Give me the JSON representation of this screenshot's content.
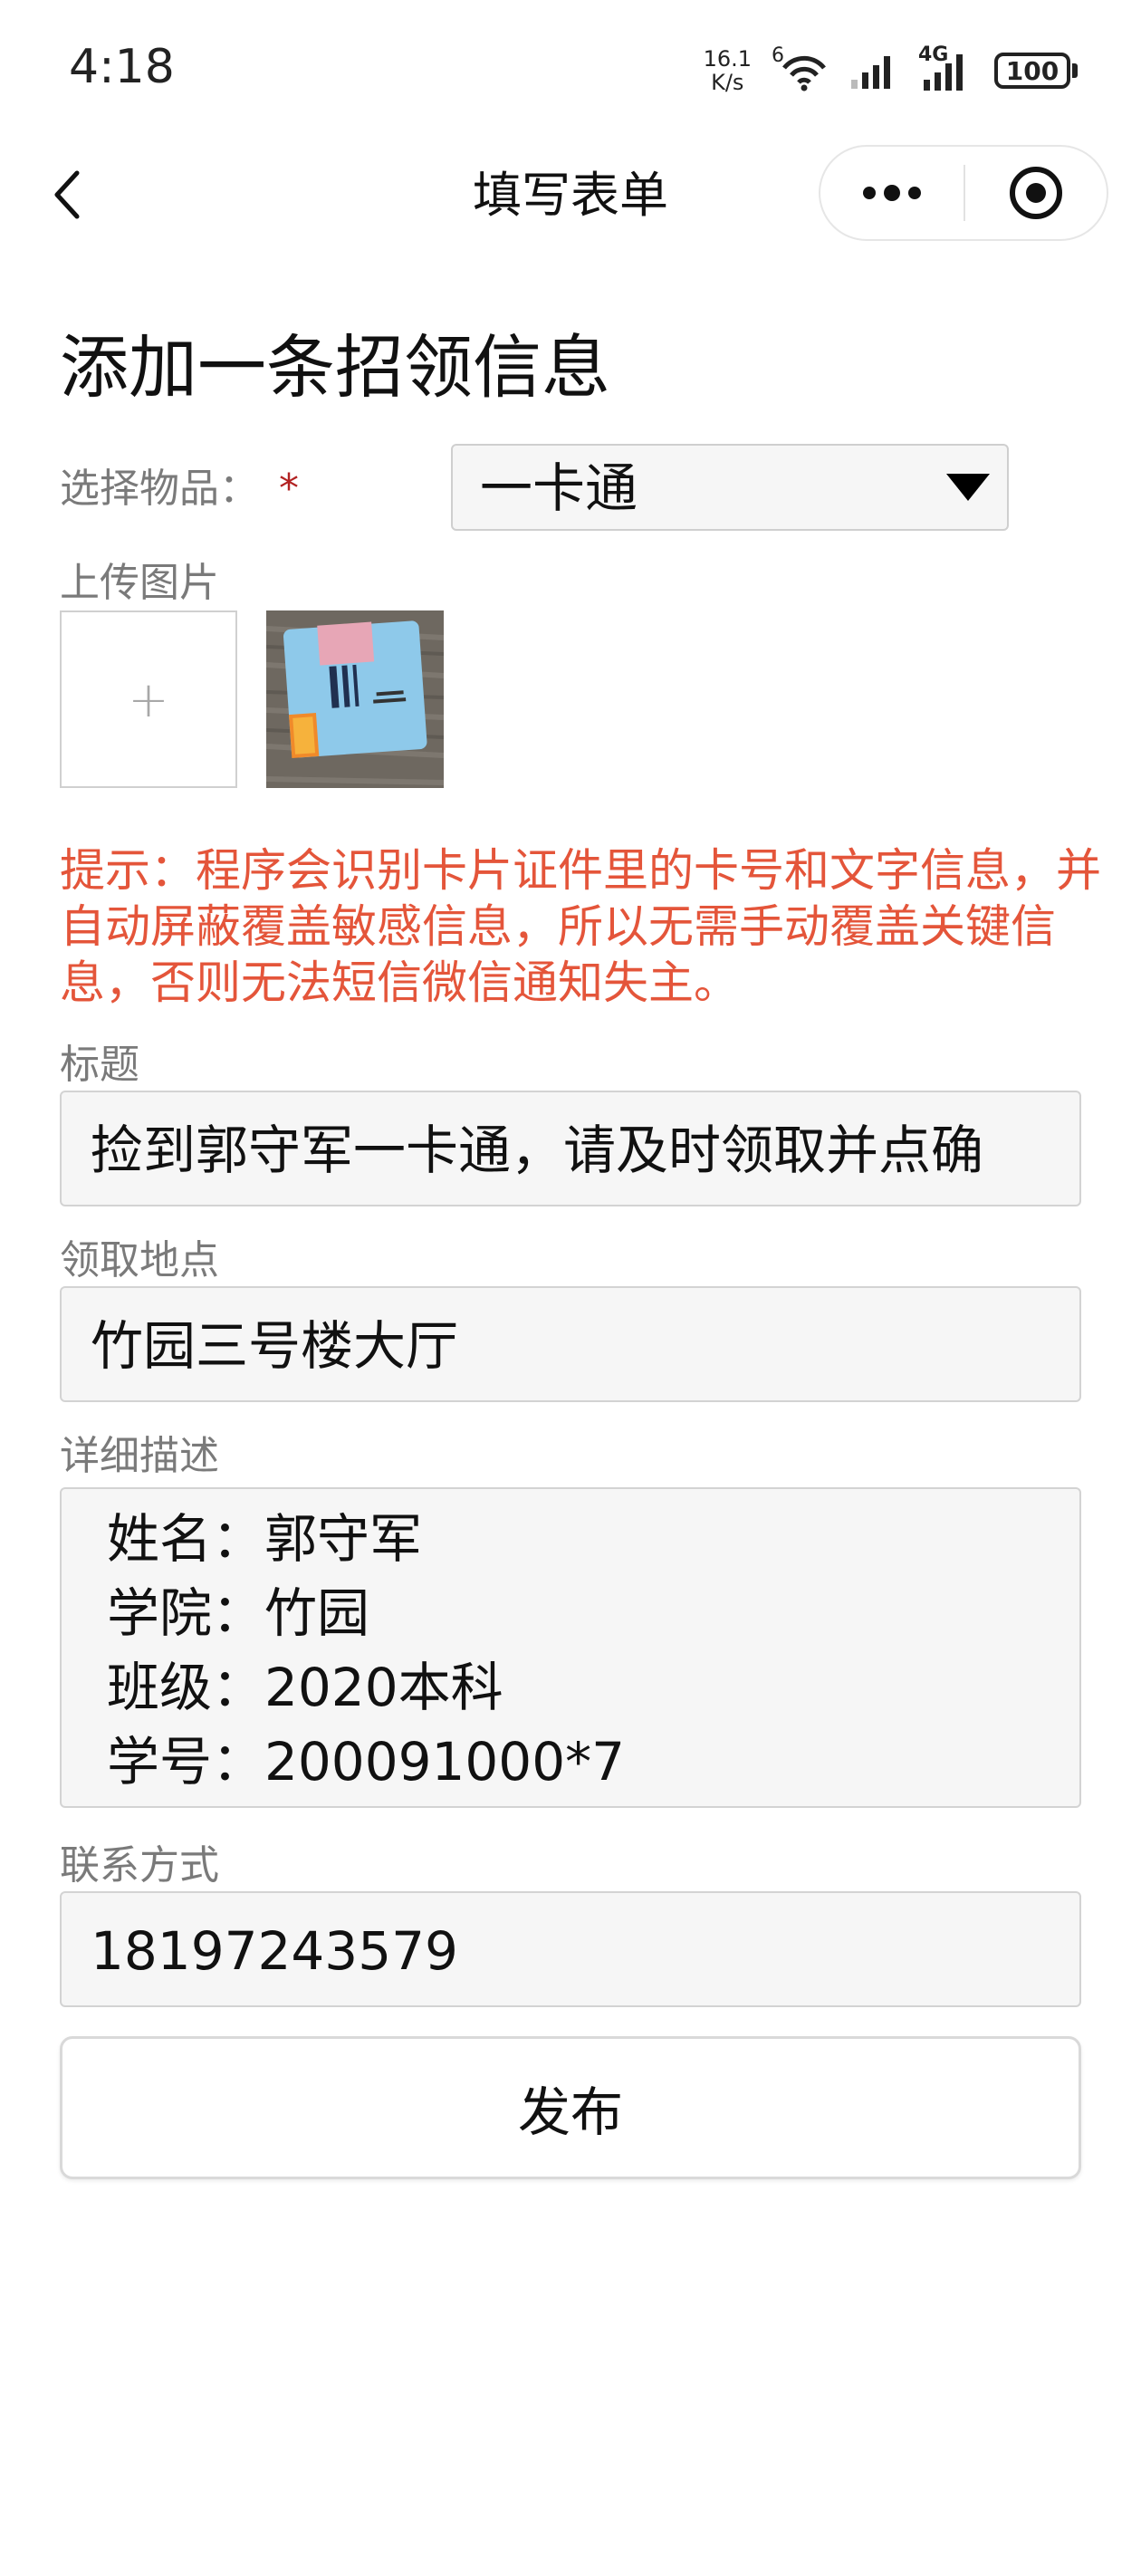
{
  "status_bar": {
    "time": "4:18",
    "net_speed_value": "16.1",
    "net_speed_unit": "K/s",
    "wifi_badge": "6",
    "signal_badge": "4G",
    "battery": "100"
  },
  "nav": {
    "title": "填写表单",
    "back_icon": "chevron-left-icon",
    "more_icon": "more-dots-icon",
    "close_icon": "target-circle-icon"
  },
  "form": {
    "heading": "添加一条招领信息",
    "item_select": {
      "label": "选择物品：",
      "required_mark": "*",
      "value": "一卡通"
    },
    "upload": {
      "label": "上传图片",
      "add_symbol": "+"
    },
    "notice": "提示：程序会识别卡片证件里的卡号和文字信息，并自动屏蔽覆盖敏感信息，所以无需手动覆盖关键信息，否则无法短信微信通知失主。",
    "title_field": {
      "label": "标题",
      "value": "捡到郭守军一卡通，请及时领取并点确"
    },
    "location_field": {
      "label": "领取地点",
      "value": "竹园三号楼大厅"
    },
    "description_field": {
      "label": "详细描述",
      "lines": [
        "姓名：郭守军",
        "学院：竹园",
        "班级：2020本科",
        "学号：200091000*7"
      ]
    },
    "contact_field": {
      "label": "联系方式",
      "value": "18197243579"
    },
    "submit_label": "发布"
  },
  "colors": {
    "notice": "#e4553a",
    "required": "#b22222",
    "label": "#7a7a7a",
    "field_bg": "#f6f6f6"
  }
}
